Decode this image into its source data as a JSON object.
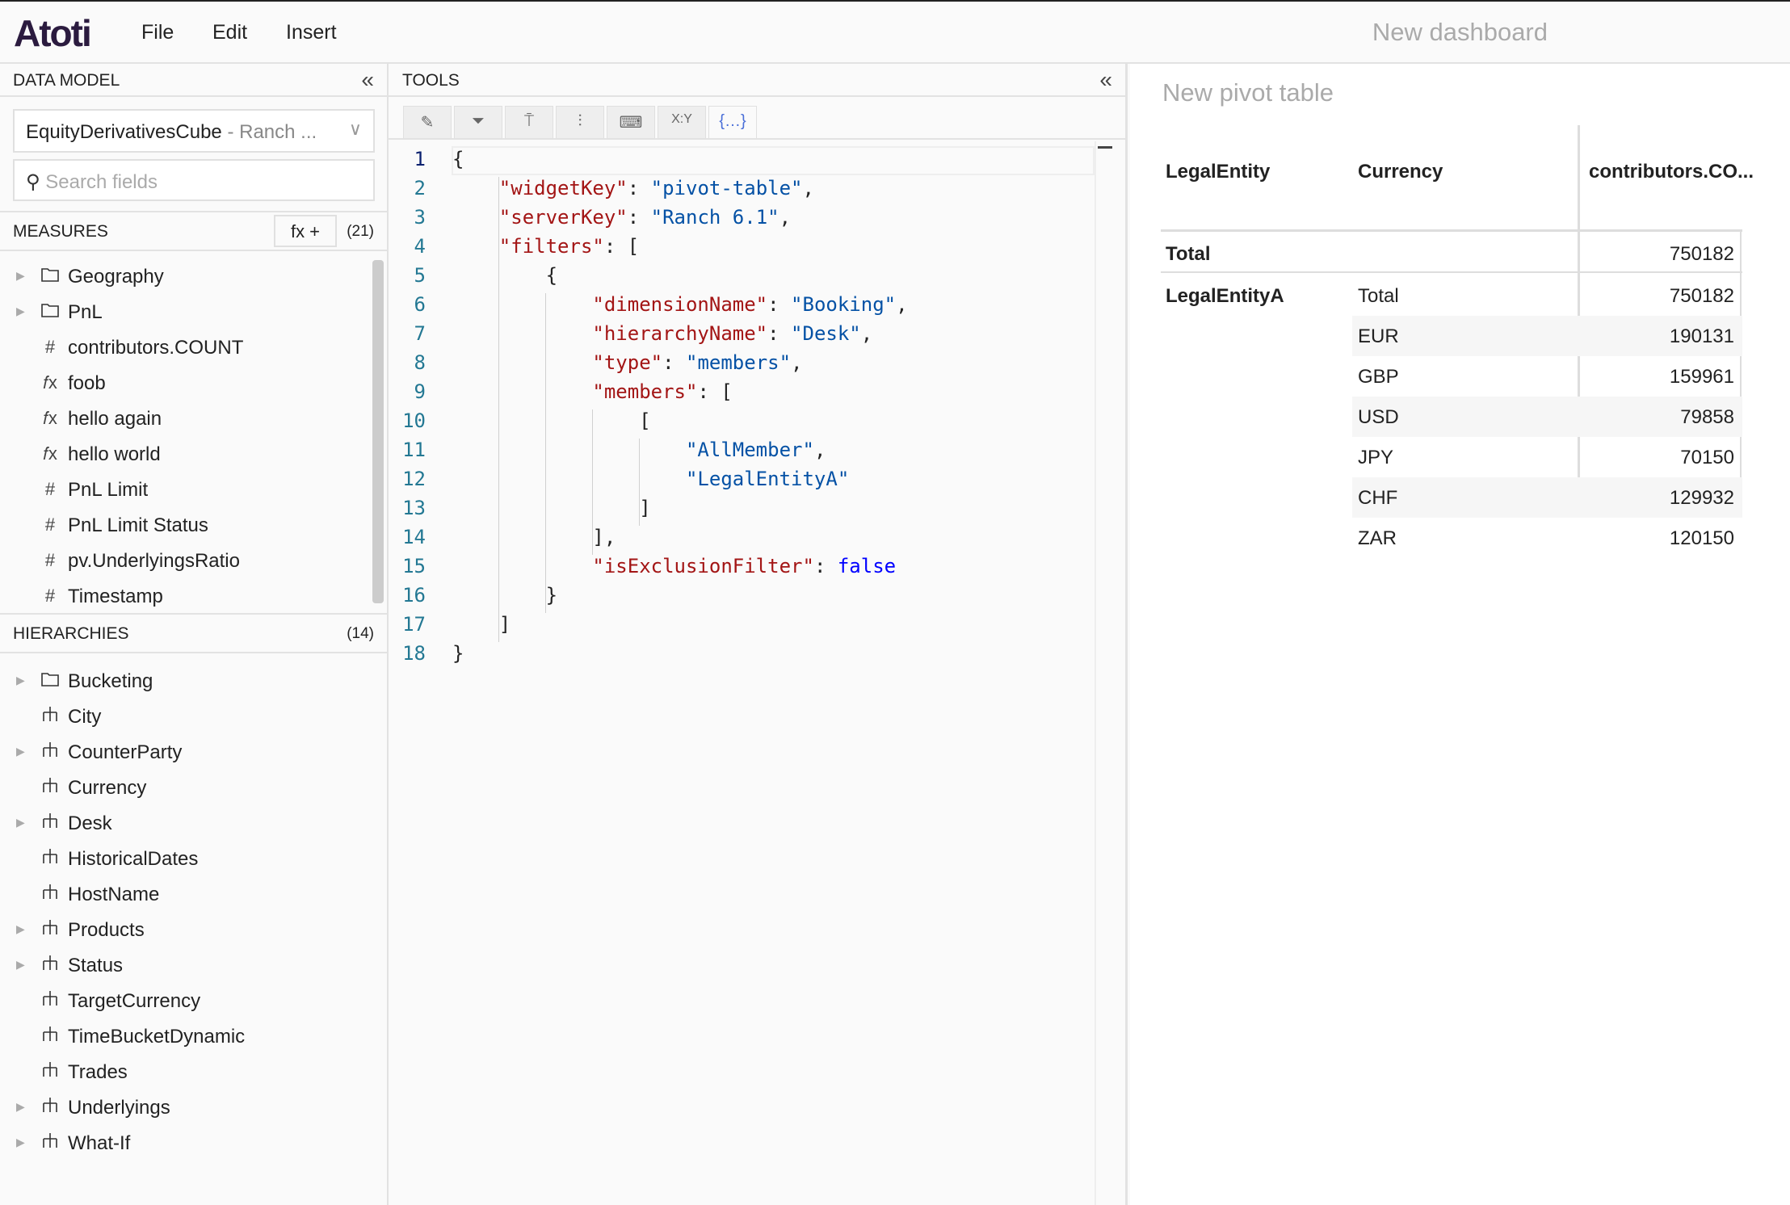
{
  "app": {
    "logo": "Atoti",
    "menu": [
      "File",
      "Edit",
      "Insert"
    ],
    "dashboard_title": "New dashboard"
  },
  "data_model": {
    "title": "DATA MODEL",
    "cube": "EquityDerivativesCube",
    "server": " - Ranch ...",
    "search_placeholder": "Search fields",
    "measures_label": "MEASURES",
    "measures_count": "(21)",
    "fx_button": "fx +",
    "measures": [
      {
        "label": "Geography",
        "icon": "folder-icon",
        "expandable": true
      },
      {
        "label": "PnL",
        "icon": "folder-icon",
        "expandable": true
      },
      {
        "label": "contributors.COUNT",
        "icon": "hash-icon"
      },
      {
        "label": "foob",
        "icon": "fx-icon"
      },
      {
        "label": "hello again",
        "icon": "fx-icon"
      },
      {
        "label": "hello world",
        "icon": "fx-icon"
      },
      {
        "label": "PnL Limit",
        "icon": "hash-icon"
      },
      {
        "label": "PnL Limit Status",
        "icon": "hash-icon"
      },
      {
        "label": "pv.UnderlyingsRatio",
        "icon": "hash-icon"
      },
      {
        "label": "Timestamp",
        "icon": "hash-icon"
      }
    ],
    "hierarchies_label": "HIERARCHIES",
    "hierarchies_count": "(14)",
    "hierarchies": [
      {
        "label": "Bucketing",
        "icon": "folder-icon",
        "expandable": true
      },
      {
        "label": "City",
        "icon": "hierarchy-icon"
      },
      {
        "label": "CounterParty",
        "icon": "hierarchy-icon",
        "expandable": true
      },
      {
        "label": "Currency",
        "icon": "hierarchy-icon"
      },
      {
        "label": "Desk",
        "icon": "hierarchy-icon",
        "expandable": true
      },
      {
        "label": "HistoricalDates",
        "icon": "hierarchy-icon"
      },
      {
        "label": "HostName",
        "icon": "hierarchy-icon"
      },
      {
        "label": "Products",
        "icon": "hierarchy-icon",
        "expandable": true
      },
      {
        "label": "Status",
        "icon": "hierarchy-icon",
        "expandable": true
      },
      {
        "label": "TargetCurrency",
        "icon": "hierarchy-icon"
      },
      {
        "label": "TimeBucketDynamic",
        "icon": "hierarchy-icon"
      },
      {
        "label": "Trades",
        "icon": "hierarchy-icon"
      },
      {
        "label": "Underlyings",
        "icon": "hierarchy-icon",
        "expandable": true
      },
      {
        "label": "What-If",
        "icon": "hierarchy-icon",
        "expandable": true
      }
    ]
  },
  "tools": {
    "title": "TOOLS",
    "tabs": [
      {
        "icon": "pencil-icon",
        "glyph": "✎"
      },
      {
        "icon": "filter-icon",
        "glyph": "⏷"
      },
      {
        "icon": "paint-roller-icon",
        "glyph": "⍑"
      },
      {
        "icon": "sliders-icon",
        "glyph": "⫶"
      },
      {
        "icon": "terminal-icon",
        "glyph": "⌨"
      },
      {
        "icon": "xy-icon",
        "glyph": "X:Y"
      },
      {
        "icon": "json-icon",
        "glyph": "{…}",
        "active": true
      }
    ],
    "code_lines": [
      [
        [
          "p",
          "{"
        ]
      ],
      [
        [
          "p",
          "    "
        ],
        [
          "k",
          "\"widgetKey\""
        ],
        [
          "p",
          ": "
        ],
        [
          "s",
          "\"pivot-table\""
        ],
        [
          "p",
          ","
        ]
      ],
      [
        [
          "p",
          "    "
        ],
        [
          "k",
          "\"serverKey\""
        ],
        [
          "p",
          ": "
        ],
        [
          "s",
          "\"Ranch 6.1\""
        ],
        [
          "p",
          ","
        ]
      ],
      [
        [
          "p",
          "    "
        ],
        [
          "k",
          "\"filters\""
        ],
        [
          "p",
          ": ["
        ]
      ],
      [
        [
          "p",
          "        {"
        ]
      ],
      [
        [
          "p",
          "            "
        ],
        [
          "k",
          "\"dimensionName\""
        ],
        [
          "p",
          ": "
        ],
        [
          "s",
          "\"Booking\""
        ],
        [
          "p",
          ","
        ]
      ],
      [
        [
          "p",
          "            "
        ],
        [
          "k",
          "\"hierarchyName\""
        ],
        [
          "p",
          ": "
        ],
        [
          "s",
          "\"Desk\""
        ],
        [
          "p",
          ","
        ]
      ],
      [
        [
          "p",
          "            "
        ],
        [
          "k",
          "\"type\""
        ],
        [
          "p",
          ": "
        ],
        [
          "s",
          "\"members\""
        ],
        [
          "p",
          ","
        ]
      ],
      [
        [
          "p",
          "            "
        ],
        [
          "k",
          "\"members\""
        ],
        [
          "p",
          ": ["
        ]
      ],
      [
        [
          "p",
          "                ["
        ]
      ],
      [
        [
          "p",
          "                    "
        ],
        [
          "s",
          "\"AllMember\""
        ],
        [
          "p",
          ","
        ]
      ],
      [
        [
          "p",
          "                    "
        ],
        [
          "s",
          "\"LegalEntityA\""
        ]
      ],
      [
        [
          "p",
          "                ]"
        ]
      ],
      [
        [
          "p",
          "            ],"
        ]
      ],
      [
        [
          "p",
          "            "
        ],
        [
          "k",
          "\"isExclusionFilter\""
        ],
        [
          "p",
          ": "
        ],
        [
          "b",
          "false"
        ]
      ],
      [
        [
          "p",
          "        }"
        ]
      ],
      [
        [
          "p",
          "    ]"
        ]
      ],
      [
        [
          "p",
          "}"
        ]
      ]
    ]
  },
  "pivot": {
    "title": "New pivot table",
    "headers": [
      "LegalEntity",
      "Currency",
      "contributors.CO..."
    ],
    "rows": [
      {
        "c1": "Total",
        "c2": "",
        "value": "750182",
        "bold": true
      },
      {
        "c1": "LegalEntityA",
        "c2": "Total",
        "value": "750182",
        "bold1": true
      },
      {
        "c1": "",
        "c2": "EUR",
        "value": "190131"
      },
      {
        "c1": "",
        "c2": "GBP",
        "value": "159961"
      },
      {
        "c1": "",
        "c2": "USD",
        "value": "79858"
      },
      {
        "c1": "",
        "c2": "JPY",
        "value": "70150"
      },
      {
        "c1": "",
        "c2": "CHF",
        "value": "129932"
      },
      {
        "c1": "",
        "c2": "ZAR",
        "value": "120150"
      }
    ]
  }
}
